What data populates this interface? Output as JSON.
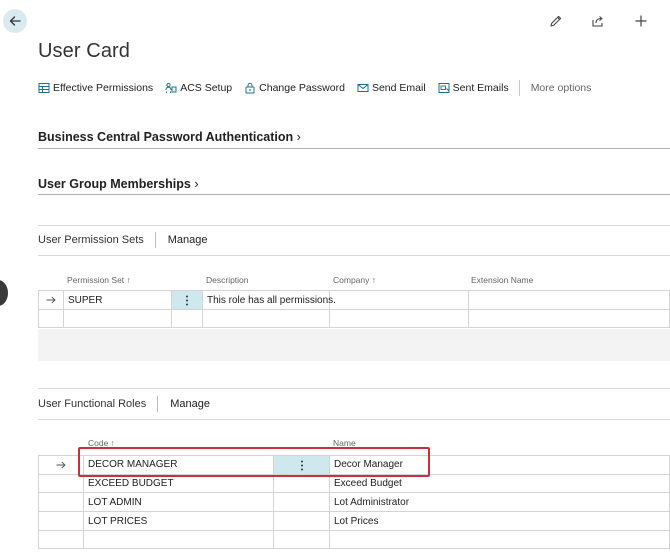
{
  "header": {
    "title": "User Card",
    "accent_color": "#d9ebf0",
    "icons": [
      "back-arrow-icon",
      "edit-pencil-icon",
      "share-icon",
      "plus-icon"
    ]
  },
  "actions": {
    "effective_permissions": "Effective Permissions",
    "acs_setup": "ACS Setup",
    "change_password": "Change Password",
    "send_email": "Send Email",
    "sent_emails": "Sent Emails",
    "more_options": "More options"
  },
  "sections": {
    "bc_password_auth": "Business Central Password Authentication",
    "user_group_memberships": "User Group Memberships"
  },
  "permission_sets": {
    "title": "User Permission Sets",
    "manage": "Manage",
    "columns": {
      "permission_set": "Permission Set ↑",
      "description": "Description",
      "company": "Company ↑",
      "extension_name": "Extension Name"
    },
    "rows": [
      {
        "permission_set": "SUPER",
        "description": "This role has all permissions.",
        "company": "",
        "extension_name": ""
      }
    ]
  },
  "functional_roles": {
    "title": "User Functional Roles",
    "manage": "Manage",
    "columns": {
      "code": "Code ↑",
      "name": "Name"
    },
    "rows": [
      {
        "code": "DECOR MANAGER",
        "name": "Decor Manager"
      },
      {
        "code": "EXCEED BUDGET",
        "name": "Exceed Budget"
      },
      {
        "code": "LOT ADMIN",
        "name": "Lot Administrator"
      },
      {
        "code": "LOT PRICES",
        "name": "Lot Prices"
      }
    ],
    "highlight_color": "#c8313a"
  }
}
